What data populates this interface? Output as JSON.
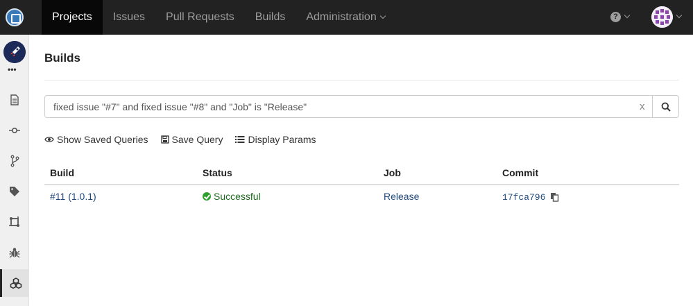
{
  "nav": {
    "items": [
      {
        "label": "Projects",
        "active": true
      },
      {
        "label": "Issues",
        "active": false
      },
      {
        "label": "Pull Requests",
        "active": false
      },
      {
        "label": "Builds",
        "active": false
      },
      {
        "label": "Administration",
        "active": false,
        "dropdown": true
      }
    ],
    "help_icon": "question-circle-icon",
    "colors": {
      "bar": "#222222",
      "active_bg": "#080808",
      "text": "#9d9d9d"
    }
  },
  "sidebar": {
    "project_avatar": "rocket-icon",
    "more": "•••",
    "items": [
      {
        "name": "files-icon",
        "active": false
      },
      {
        "name": "commits-icon",
        "active": false
      },
      {
        "name": "branches-icon",
        "active": false
      },
      {
        "name": "tags-icon",
        "active": false
      },
      {
        "name": "pull-requests-icon",
        "active": false
      },
      {
        "name": "issues-bug-icon",
        "active": false
      },
      {
        "name": "builds-cubes-icon",
        "active": true
      }
    ]
  },
  "page": {
    "title": "Builds",
    "search": {
      "value": "fixed issue \"#7\" and fixed issue \"#8\" and \"Job\" is \"Release\"",
      "clear": "x"
    },
    "actions": {
      "show_saved": "Show Saved Queries",
      "save_query": "Save Query",
      "display_params": "Display Params"
    },
    "table": {
      "headers": [
        "Build",
        "Status",
        "Job",
        "Commit"
      ],
      "rows": [
        {
          "build": "#11 (1.0.1)",
          "status": "Successful",
          "job": "Release",
          "commit": "17fca796"
        }
      ]
    },
    "colors": {
      "link": "#1f497d",
      "success": "#2ea02e"
    }
  }
}
